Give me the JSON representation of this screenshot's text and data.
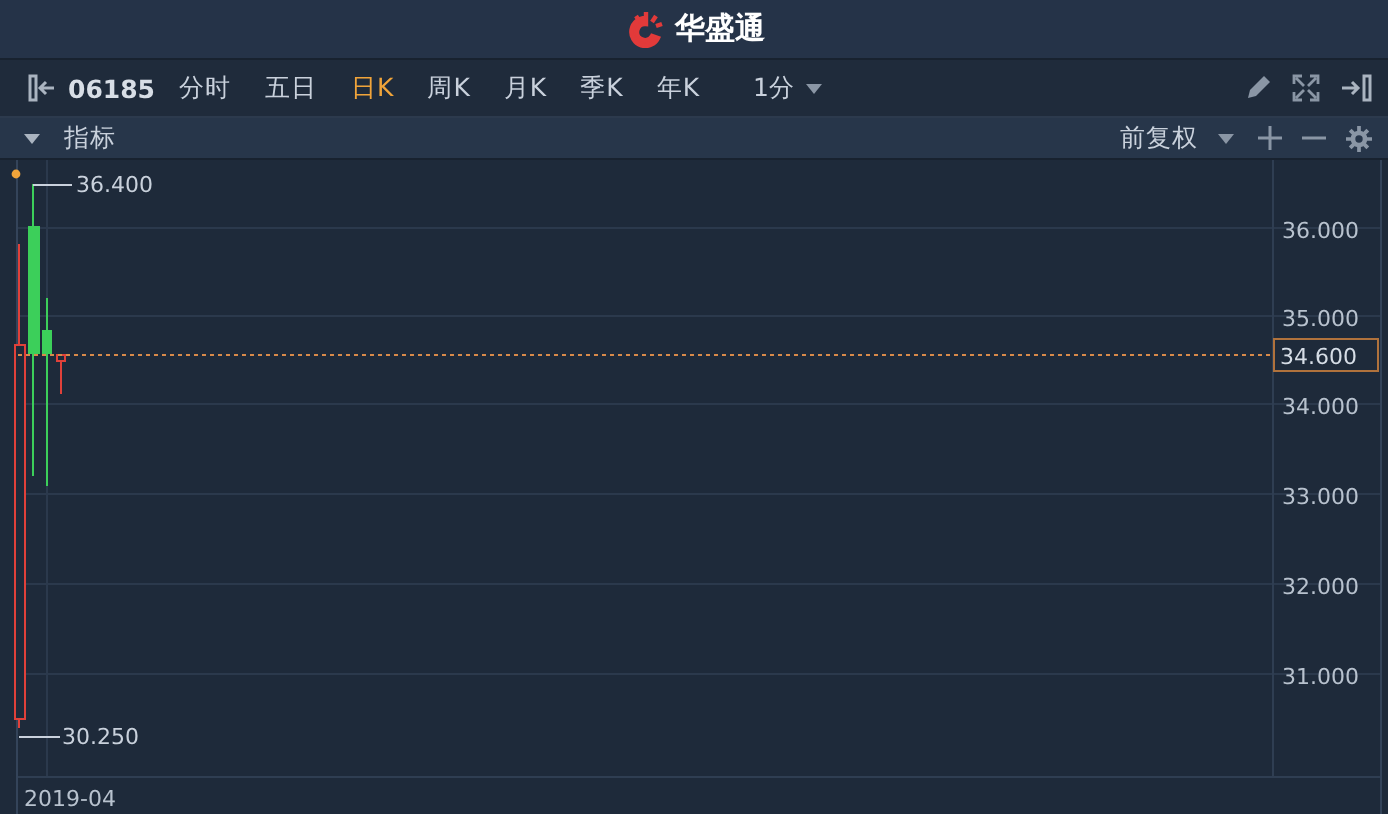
{
  "app": {
    "name": "华盛通"
  },
  "toolbar": {
    "symbol": "06185",
    "periods": [
      {
        "label": "分时",
        "selected": false
      },
      {
        "label": "五日",
        "selected": false
      },
      {
        "label": "日K",
        "selected": true
      },
      {
        "label": "周K",
        "selected": false
      },
      {
        "label": "月K",
        "selected": false
      },
      {
        "label": "季K",
        "selected": false
      },
      {
        "label": "年K",
        "selected": false
      }
    ],
    "interval": "1分"
  },
  "indicator_bar": {
    "label": "指标",
    "adjustment": "前复权"
  },
  "chart": {
    "high_label": "36.400",
    "low_label": "30.250",
    "price_ticks": [
      "36.000",
      "35.000",
      "34.000",
      "33.000",
      "32.000",
      "31.000"
    ],
    "current_price": "34.600",
    "date_label": "2019-04"
  }
}
